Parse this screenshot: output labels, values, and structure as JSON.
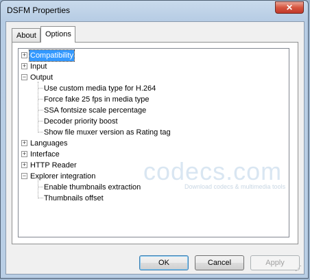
{
  "window": {
    "title": "DSFM Properties"
  },
  "tabs": [
    {
      "label": "About"
    },
    {
      "label": "Options"
    }
  ],
  "tree": {
    "nodes": [
      {
        "label": "Compatibility",
        "expander": "+"
      },
      {
        "label": "Input",
        "expander": "+"
      },
      {
        "label": "Output",
        "expander": "−"
      },
      {
        "label": "Use custom media type for H.264"
      },
      {
        "label": "Force fake 25 fps in media type"
      },
      {
        "label": "SSA fontsize scale percentage"
      },
      {
        "label": "Decoder priority boost"
      },
      {
        "label": "Show file muxer version as Rating tag"
      },
      {
        "label": "Languages",
        "expander": "+"
      },
      {
        "label": "Interface",
        "expander": "+"
      },
      {
        "label": "HTTP Reader",
        "expander": "+"
      },
      {
        "label": "Explorer integration",
        "expander": "−"
      },
      {
        "label": "Enable thumbnails extraction"
      },
      {
        "label": "Thumbnails offset"
      }
    ]
  },
  "watermark": {
    "main": "codecs.com",
    "sub": "Download codecs  &  multimedia tools"
  },
  "buttons": {
    "ok": "OK",
    "cancel": "Cancel",
    "apply": "Apply"
  },
  "icons": {
    "close": "close-icon",
    "expander": "tree-expander-icon",
    "grip": "resize-grip-icon"
  },
  "colors": {
    "selection": "#3399ff",
    "close_button": "#c0392b",
    "title_bar": "#b9cee5"
  }
}
